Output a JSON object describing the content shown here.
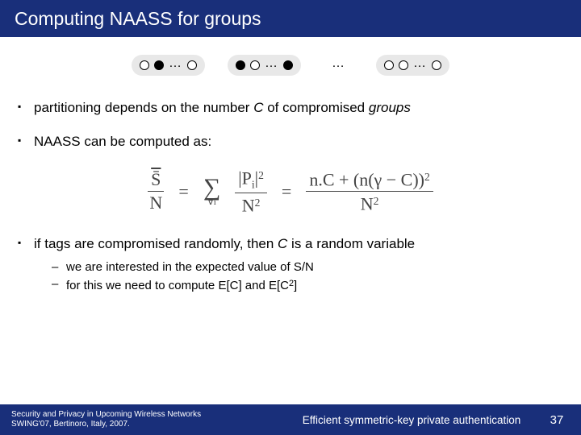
{
  "title": "Computing NAASS for groups",
  "bullets": {
    "b1_pre": "partitioning depends on the number ",
    "b1_var": "C",
    "b1_mid": " of compromised ",
    "b1_suf": "groups",
    "b2": "NAASS can be computed as:",
    "b3_pre": "if tags are compromised randomly, then ",
    "b3_var": "C",
    "b3_suf": " is a random variable",
    "s1": "we are interested in the expected value of S/N",
    "s2_pre": "for this we need to compute E[C] and E[C",
    "s2_exp": "2",
    "s2_suf": "]"
  },
  "formula": {
    "lhs_num": "S̄",
    "lhs_den": "N",
    "eq": "=",
    "sum_top": "",
    "sum_bot": "∀i",
    "mid_num_pre": "|P",
    "mid_num_sub": "i",
    "mid_num_suf": "|",
    "mid_num_exp": "2",
    "mid_den_base": "N",
    "mid_den_exp": "2",
    "rhs_num": "n.C + (n(γ − C))",
    "rhs_num_exp": "2",
    "rhs_den_base": "N",
    "rhs_den_exp": "2"
  },
  "footer": {
    "left_l1": "Security and Privacy in Upcoming Wireless Networks",
    "left_l2": "SWING'07, Bertinoro, Italy, 2007.",
    "center": "Efficient symmetric-key private authentication",
    "page": "37"
  }
}
